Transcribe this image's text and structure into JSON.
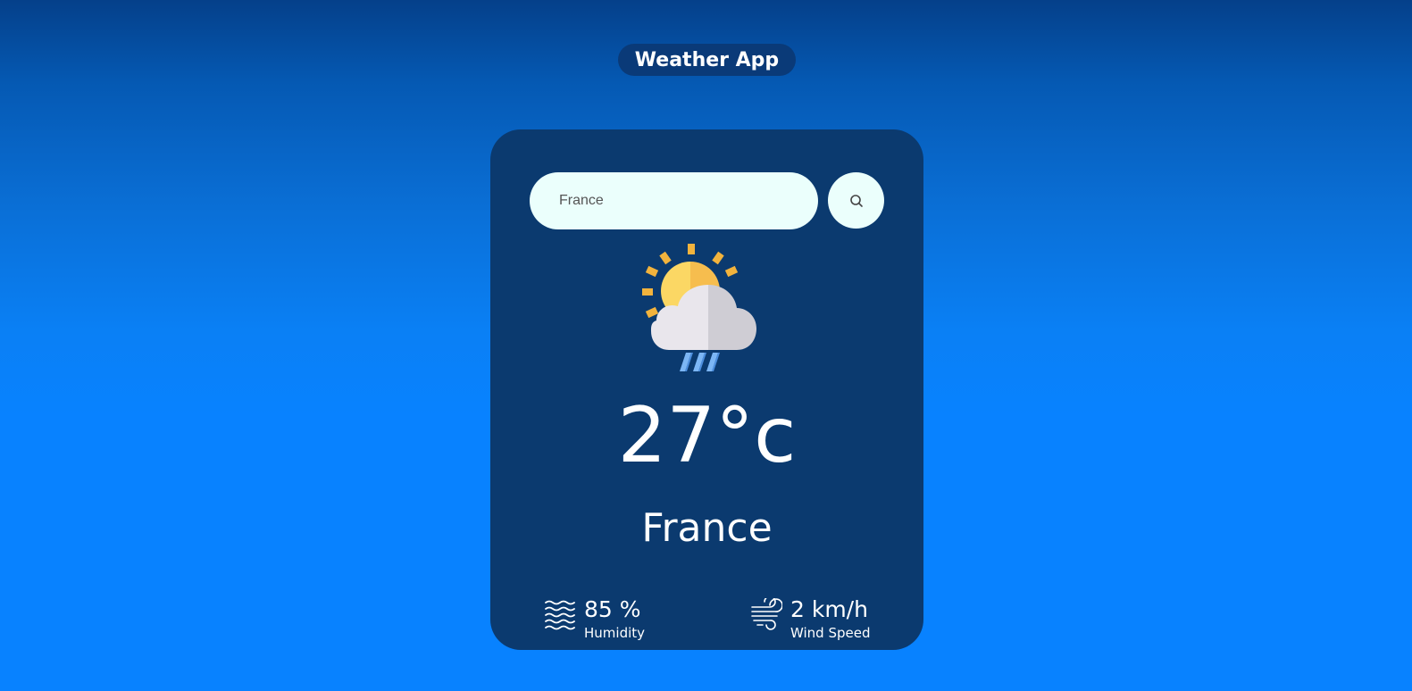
{
  "app": {
    "title": "Weather App"
  },
  "search": {
    "value": "France",
    "placeholder": "",
    "button_icon": "search-icon"
  },
  "weather": {
    "icon": "sun-cloud-rain-icon",
    "temperature": "27°c",
    "city": "France",
    "humidity": {
      "icon": "humidity-waves-icon",
      "value": "85 %",
      "label": "Humidity"
    },
    "wind": {
      "icon": "wind-icon",
      "value": "2 km/h",
      "label": "Wind Speed"
    }
  },
  "colors": {
    "card": "#0b3a6f",
    "input": "#ebfffc",
    "background_top": "#05408a",
    "background_bottom": "#0882ff"
  }
}
